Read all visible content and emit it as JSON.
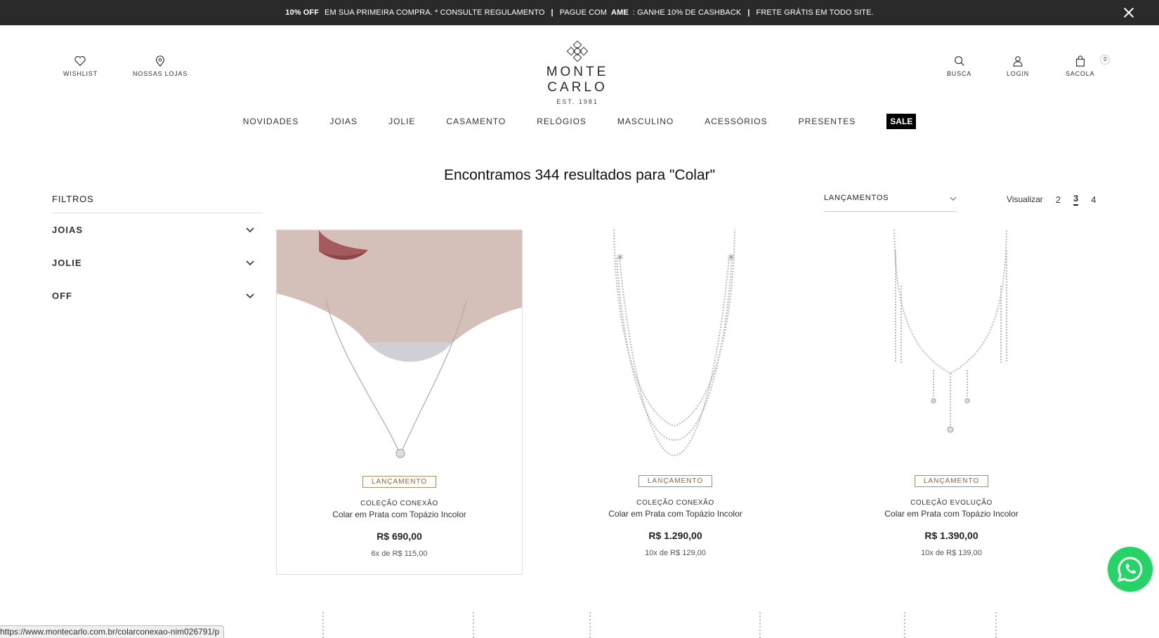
{
  "promo": {
    "strong": "10% OFF",
    "text1": "EM SUA PRIMEIRA COMPRA. * CONSULTE REGULAMENTO",
    "sep": "|",
    "text2": "PAGUE COM",
    "ame": "AME",
    "text3": ": GANHE 10% DE CASHBACK",
    "text4": "FRETE GRÁTIS EM TODO SITE."
  },
  "header": {
    "wishlist": "WISHLIST",
    "stores": "NOSSAS LOJAS",
    "search": "BUSCA",
    "login": "LOGIN",
    "bag": "SACOLA",
    "bag_count": "0",
    "brand": "MONTE CARLO",
    "est": "EST. 1981"
  },
  "nav": [
    "NOVIDADES",
    "JOIAS",
    "JOLIE",
    "CASAMENTO",
    "RELÓGIOS",
    "MASCULINO",
    "ACESSÓRIOS",
    "PRESENTES"
  ],
  "nav_sale": "SALE",
  "results_title": "Encontramos 344 resultados para \"Colar\"",
  "filters": {
    "head": "FILTROS",
    "items": [
      "JOIAS",
      "JOLIE",
      "OFF"
    ]
  },
  "sort": {
    "label": "LANÇAMENTOS"
  },
  "view": {
    "label": "Visualizar",
    "options": [
      "2",
      "3",
      "4"
    ],
    "selected": "3"
  },
  "products": [
    {
      "tag": "LANÇAMENTO",
      "collection": "COLEÇÃO CONEXÃO",
      "name": "Colar em Prata com Topázio Incolor",
      "price": "R$ 690,00",
      "installments": "6x de R$ 115,00"
    },
    {
      "tag": "LANÇAMENTO",
      "collection": "COLEÇÃO CONEXÃO",
      "name": "Colar em Prata com Topázio Incolor",
      "price": "R$ 1.290,00",
      "installments": "10x de R$ 129,00"
    },
    {
      "tag": "LANÇAMENTO",
      "collection": "COLEÇÃO EVOLUÇÃO",
      "name": "Colar em Prata com Topázio Incolor",
      "price": "R$ 1.390,00",
      "installments": "10x de R$ 139,00"
    }
  ],
  "status_url": "https://www.montecarlo.com.br/colarconexao-nim026791/p",
  "colors": {
    "topbar": "#2a2a2a",
    "tag_border": "#b08e6b",
    "whatsapp": "#25d366"
  },
  "icons": [
    "heart-icon",
    "location-pin-icon",
    "search-icon",
    "user-icon",
    "bag-icon",
    "close-icon",
    "chevron-down-icon",
    "whatsapp-icon"
  ]
}
